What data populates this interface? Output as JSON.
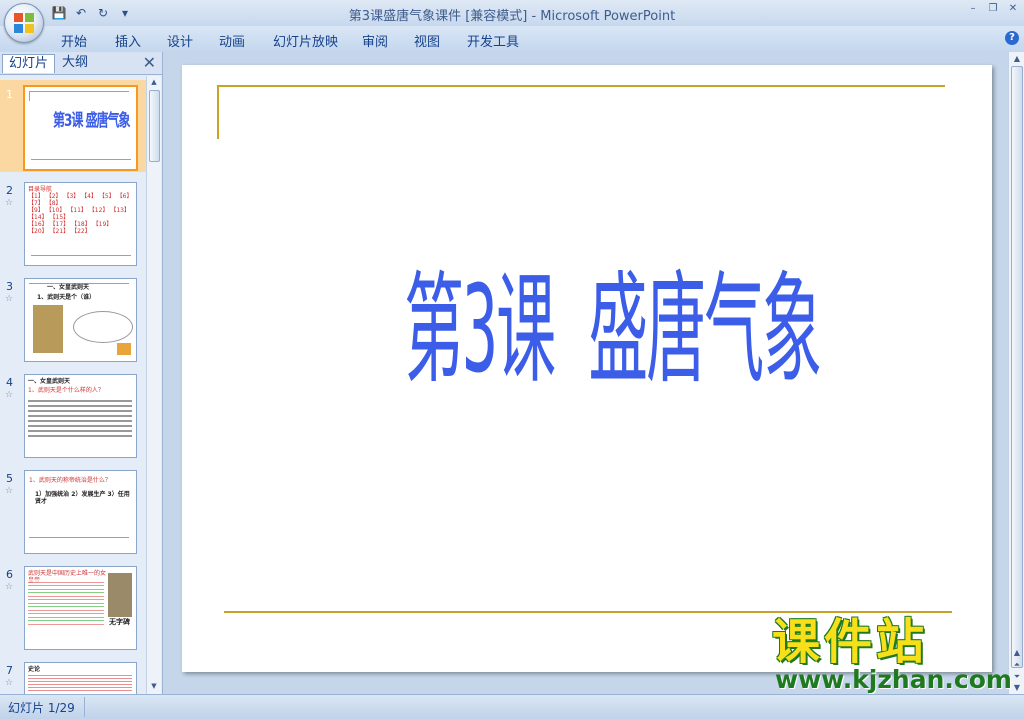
{
  "window": {
    "title": "第3课盛唐气象课件 [兼容模式] - Microsoft PowerPoint",
    "controls": [
      "–",
      "❐",
      "✕"
    ]
  },
  "quick_access": [
    {
      "name": "save-icon",
      "glyph": "💾"
    },
    {
      "name": "undo-icon",
      "glyph": "↶"
    },
    {
      "name": "redo-icon",
      "glyph": "↻"
    },
    {
      "name": "customize-icon",
      "glyph": "▾"
    }
  ],
  "ribbon": {
    "tabs": [
      "开始",
      "插入",
      "设计",
      "动画",
      "幻灯片放映",
      "审阅",
      "视图",
      "开发工具"
    ],
    "help": "?"
  },
  "left_pane": {
    "tabs": [
      "幻灯片",
      "大纲"
    ],
    "close": "✕",
    "slides": [
      {
        "num": "1",
        "star": "",
        "title": "第3课 盛唐气象"
      },
      {
        "num": "2",
        "star": "☆",
        "text": "目录导航\n【1】 【2】 【3】 【4】 【5】 【6】 【7】 【8】\n【9】 【10】 【11】 【12】 【13】 【14】 【15】\n【16】 【17】 【18】 【19】 【20】 【21】 【22】"
      },
      {
        "num": "3",
        "star": "☆",
        "heading": "一、女皇武则天",
        "sub": "1、武则天是个（谁）"
      },
      {
        "num": "4",
        "star": "☆",
        "heading": "一、女皇武则天",
        "sub": "1、武则天是个什么样的人？"
      },
      {
        "num": "5",
        "star": "☆",
        "heading": "1、武则天的称帝统治是什么？",
        "sub": "1）加强统治 2）发展生产 3）任用贤才"
      },
      {
        "num": "6",
        "star": "☆",
        "text": "武则天是中国历史上唯一的女皇帝",
        "side": "无字碑"
      },
      {
        "num": "7",
        "star": "☆",
        "text": "史论"
      }
    ]
  },
  "slide": {
    "title": "第3课  盛唐气象"
  },
  "watermark": {
    "title": "课件站",
    "url": "www.kjzhan.com"
  },
  "status_bar": {
    "slide_indicator": "幻灯片 1/29"
  },
  "colors": {
    "title_blue": "#3b5de8",
    "gold_line": "#c9a227",
    "selected_thumb": "#fbd8a1"
  }
}
